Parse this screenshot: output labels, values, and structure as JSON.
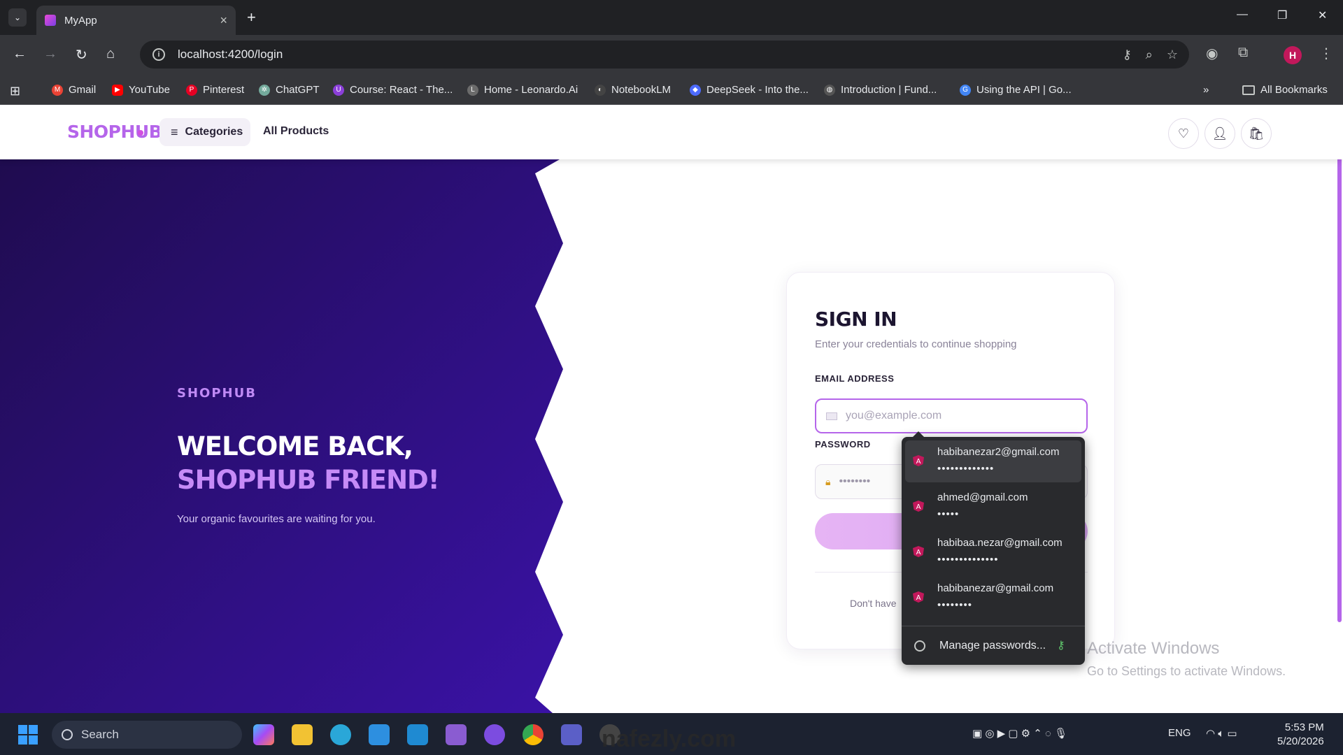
{
  "browser": {
    "tab_title": "MyApp",
    "url": "localhost:4200/login",
    "profile_initial": "H",
    "bookmarks": [
      {
        "label": "Gmail",
        "color": "#ea4335"
      },
      {
        "label": "YouTube",
        "color": "#ff0000"
      },
      {
        "label": "Pinterest",
        "color": "#e60023"
      },
      {
        "label": "ChatGPT",
        "color": "#74aa9c"
      },
      {
        "label": "Course: React - The...",
        "color": "#8b3fd9"
      },
      {
        "label": "Home - Leonardo.Ai",
        "color": "#6b6b6b"
      },
      {
        "label": "NotebookLM",
        "color": "#444"
      },
      {
        "label": "DeepSeek - Into the...",
        "color": "#4d6bfe"
      },
      {
        "label": "Introduction | Fund...",
        "color": "#555"
      },
      {
        "label": "Using the API | Go...",
        "color": "#4285f4"
      }
    ],
    "all_bookmarks": "All Bookmarks"
  },
  "app": {
    "logo": "SHOPHUB",
    "categories": "Categories",
    "all_products": "All Products"
  },
  "hero": {
    "brand": "SHOPHUB",
    "line1": "WELCOME BACK,",
    "line2": "SHOPHUB FRIEND!",
    "subtitle": "Your organic favourites are waiting for you."
  },
  "form": {
    "title": "SIGN IN",
    "subtitle": "Enter your credentials to continue shopping",
    "email_label": "EMAIL ADDRESS",
    "email_placeholder": "you@example.com",
    "password_label": "PASSWORD",
    "password_value": "••••••••",
    "signup_prompt": "Don't have"
  },
  "autofill": {
    "items": [
      {
        "email": "habibanezar2@gmail.com",
        "password": "•••••••••••••"
      },
      {
        "email": "ahmed@gmail.com",
        "password": "•••••"
      },
      {
        "email": "habibaa.nezar@gmail.com",
        "password": "••••••••••••••"
      },
      {
        "email": "habibanezar@gmail.com",
        "password": "••••••••"
      }
    ],
    "manage": "Manage passwords..."
  },
  "overlay": {
    "activate_title": "Activate Windows",
    "activate_sub": "Go to Settings to activate Windows.",
    "watermark": "nafezly.com"
  },
  "taskbar": {
    "search": "Search",
    "lang": "ENG",
    "time": "5:53 PM",
    "date": "5/20/2026"
  },
  "colors": {
    "brand": "#b565ea",
    "hero_bg_start": "#24105a",
    "hero_bg_end": "#3a12a6"
  }
}
